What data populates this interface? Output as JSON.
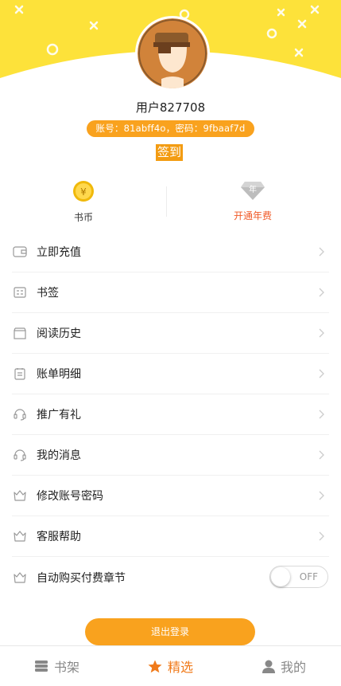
{
  "profile": {
    "username": "用户827708",
    "account_info": "账号：81abff4o，密码：9fbaaf7d",
    "signin_label": "签到"
  },
  "stats": {
    "coins_label": "书币",
    "vip_label": "开通年费",
    "vip_badge_text": "年"
  },
  "menu": {
    "items": [
      {
        "label": "立即充值",
        "icon": "wallet-icon"
      },
      {
        "label": "书签",
        "icon": "bookmark-card-icon"
      },
      {
        "label": "阅读历史",
        "icon": "history-box-icon"
      },
      {
        "label": "账单明细",
        "icon": "bill-icon"
      },
      {
        "label": "推广有礼",
        "icon": "headset-icon"
      },
      {
        "label": "我的消息",
        "icon": "headset-icon"
      },
      {
        "label": "修改账号密码",
        "icon": "crown-icon"
      },
      {
        "label": "客服帮助",
        "icon": "crown-icon"
      },
      {
        "label": "自动购买付费章节",
        "icon": "crown-icon"
      }
    ],
    "auto_buy_toggle": {
      "state": "OFF"
    }
  },
  "logout_label": "退出登录",
  "tabbar": {
    "tabs": [
      {
        "label": "书架",
        "icon": "bookshelf-icon",
        "active": false
      },
      {
        "label": "精选",
        "icon": "star-icon",
        "active": true
      },
      {
        "label": "我的",
        "icon": "user-icon",
        "active": false
      }
    ]
  },
  "colors": {
    "brand_yellow": "#fde23a",
    "accent_orange": "#f9a21e",
    "active_tab": "#f07a1a",
    "vip_text": "#f05a28"
  }
}
